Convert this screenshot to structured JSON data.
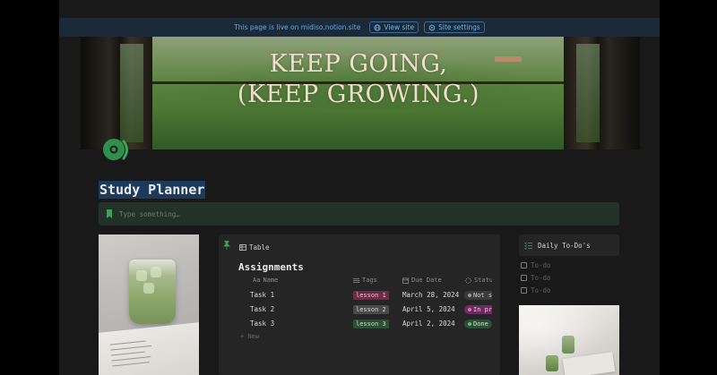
{
  "live_bar": {
    "message": "This page is live on midiso.notion.site",
    "view_site": "View site",
    "site_settings": "Site settings",
    "color": "#5ea9e8"
  },
  "banner": {
    "line1": "KEEP GOING,",
    "line2": "(KEEP GROWING.)"
  },
  "page": {
    "icon": "headphones-icon",
    "title": "Study Planner",
    "callout_placeholder": "Type something…"
  },
  "database": {
    "view_label": "Table",
    "title": "Assignments",
    "columns": [
      {
        "label": "Name",
        "icon": "Aa"
      },
      {
        "label": "Tags",
        "icon": "list-icon"
      },
      {
        "label": "Due Date",
        "icon": "calendar-icon"
      },
      {
        "label": "Status",
        "icon": "status-icon"
      }
    ],
    "rows": [
      {
        "name": "Task 1",
        "tag": "lesson 1",
        "tag_color": "#6b2d45",
        "tag_text": "#f0bfd0",
        "due": "March 28, 2024",
        "status": "Not started",
        "status_bg": "#3a3a3a",
        "status_dot": "#9a9a9a"
      },
      {
        "name": "Task 2",
        "tag": "lesson 2",
        "tag_color": "#4a4a4a",
        "tag_text": "#d8d8d8",
        "due": "April 5, 2024",
        "status": "In progress",
        "status_bg": "#6b2d5c",
        "status_dot": "#e06fc0"
      },
      {
        "name": "Task 3",
        "tag": "lesson 3",
        "tag_color": "#2d4f36",
        "tag_text": "#b9dfc3",
        "due": "April 2, 2024",
        "status": "Done",
        "status_bg": "#2d4f36",
        "status_dot": "#5fc27e"
      }
    ],
    "new_label": "+ New"
  },
  "todo": {
    "title": "Daily To-Do's",
    "items": [
      "To-do",
      "To-do",
      "To-do"
    ]
  },
  "colors": {
    "accent_green": "#3aa35a",
    "page_bg": "#191919"
  }
}
